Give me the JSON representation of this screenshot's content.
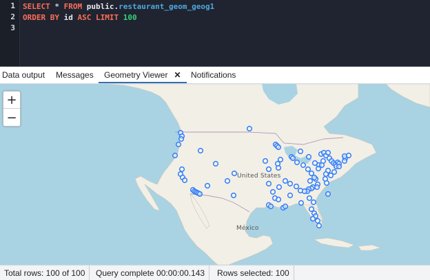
{
  "editor": {
    "line_numbers": [
      "1",
      "2",
      "3"
    ],
    "line1": {
      "kw_select": "SELECT",
      "star": "*",
      "kw_from": "FROM",
      "schema": "public.",
      "table": "restaurant_geom_geog1"
    },
    "line2": {
      "kw_order": "ORDER BY",
      "col": "id",
      "kw_asc": "ASC",
      "kw_limit": "LIMIT",
      "limit_val": "100"
    }
  },
  "tabs": [
    {
      "label": "Data output",
      "active": false
    },
    {
      "label": "Messages",
      "active": false
    },
    {
      "label": "Geometry Viewer",
      "active": true
    },
    {
      "label": "Notifications",
      "active": false
    }
  ],
  "map": {
    "zoom_in": "+",
    "zoom_out": "−",
    "labels": {
      "country_us": "United States",
      "country_mx": "México"
    },
    "colors": {
      "water": "#a9d3e3",
      "land": "#f2efe6",
      "point": "#3b82f6"
    }
  },
  "status": {
    "total_rows": "Total rows: 100 of 100",
    "query_complete": "Query complete 00:00:00.143",
    "rows_selected": "Rows selected: 100"
  }
}
